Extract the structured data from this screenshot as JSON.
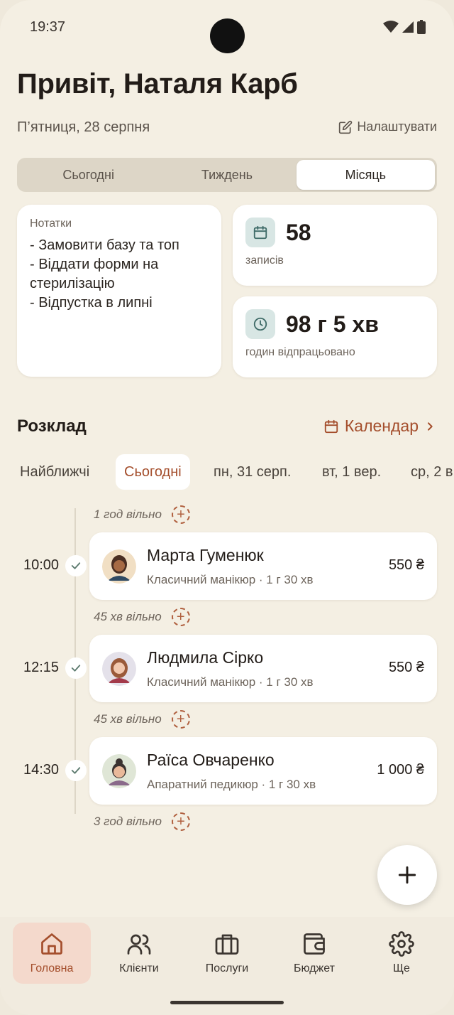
{
  "status_bar": {
    "time": "19:37"
  },
  "header": {
    "greeting": "Привіт, Наталя Карб",
    "date": "П’ятниця, 28 серпня",
    "settings_label": "Налаштувати"
  },
  "period_tabs": [
    {
      "label": "Сьогодні",
      "active": false
    },
    {
      "label": "Тиждень",
      "active": false
    },
    {
      "label": "Місяць",
      "active": true
    }
  ],
  "notes": {
    "title": "Нотатки",
    "lines": [
      "- Замовити базу та топ",
      "- Віддати форми на",
      "стерилізацію",
      "- Відпустка в липні"
    ]
  },
  "stats": {
    "appointments": {
      "value": "58",
      "label": "записів",
      "icon": "calendar-icon"
    },
    "hours": {
      "value": "98 г 5 хв",
      "label": "годин відпрацьовано",
      "icon": "clock-icon"
    }
  },
  "schedule": {
    "title": "Розклад",
    "calendar_label": "Календар",
    "chips": [
      {
        "label": "Найближчі",
        "active": false
      },
      {
        "label": "Сьогодні",
        "active": true
      },
      {
        "label": "пн, 31 серп.",
        "active": false
      },
      {
        "label": "вт, 1 вер.",
        "active": false
      },
      {
        "label": "ср, 2 в",
        "active": false
      }
    ],
    "free_slots": [
      "1 год вільно",
      "45 хв вільно",
      "45 хв вільно",
      "3 год вільно"
    ],
    "appointments": [
      {
        "time": "10:00",
        "name": "Марта Гуменюк",
        "service": "Класичний манікюр · 1 г 30 хв",
        "price": "550 ₴"
      },
      {
        "time": "12:15",
        "name": "Людмила Сірко",
        "service": "Класичний манікюр · 1 г 30 хв",
        "price": "550 ₴"
      },
      {
        "time": "14:30",
        "name": "Раїса Овчаренко",
        "service": "Апаратний педикюр · 1 г 30 хв",
        "price": "1 000 ₴"
      }
    ]
  },
  "bottom_nav": [
    {
      "label": "Головна",
      "icon": "home-icon",
      "active": true
    },
    {
      "label": "Клієнти",
      "icon": "users-icon",
      "active": false
    },
    {
      "label": "Послуги",
      "icon": "briefcase-icon",
      "active": false
    },
    {
      "label": "Бюджет",
      "icon": "wallet-icon",
      "active": false
    },
    {
      "label": "Ще",
      "icon": "gear-icon",
      "active": false
    }
  ],
  "colors": {
    "accent": "#a44e2c",
    "background": "#f4efe3",
    "card": "#ffffff",
    "icon_bg": "#d8e6e4"
  }
}
